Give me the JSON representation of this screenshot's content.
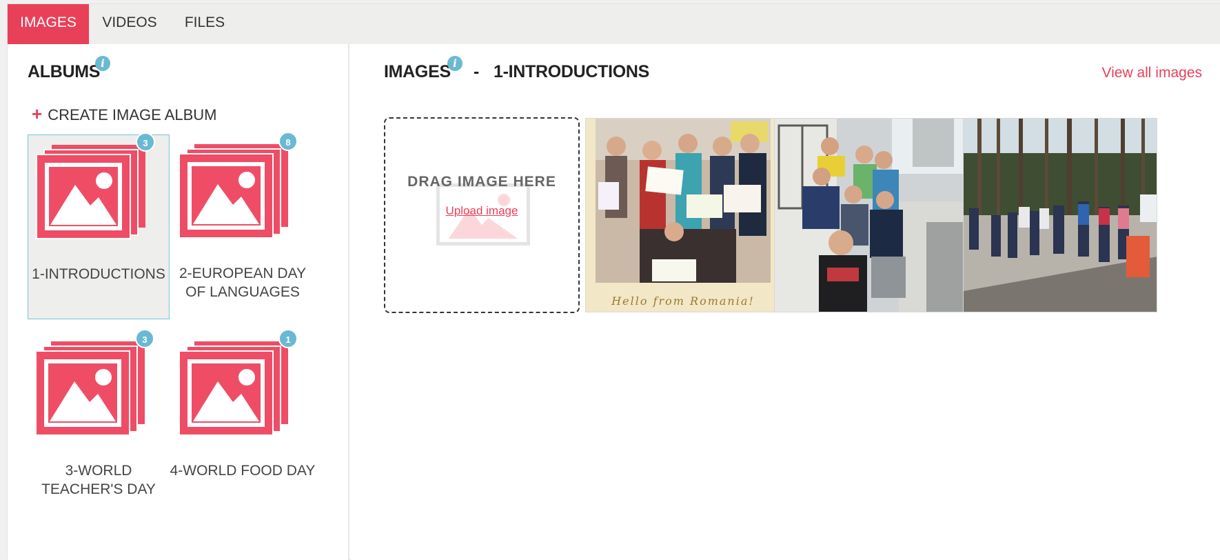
{
  "tabs": [
    {
      "label": "IMAGES",
      "active": true
    },
    {
      "label": "VIDEOS",
      "active": false
    },
    {
      "label": "FILES",
      "active": false
    }
  ],
  "albums_panel": {
    "title": "ALBUMS",
    "create_label": "CREATE IMAGE ALBUM",
    "items": [
      {
        "label": "1-INTRODUCTIONS",
        "count": "3",
        "selected": true
      },
      {
        "label": "2-EUROPEAN DAY OF LANGUAGES",
        "count": "8",
        "selected": false
      },
      {
        "label": "3-WORLD TEACHER'S DAY",
        "count": "3",
        "selected": false
      },
      {
        "label": "4-WORLD FOOD DAY",
        "count": "1",
        "selected": false
      }
    ]
  },
  "images_panel": {
    "title": "IMAGES",
    "separator": "-",
    "album_name": "1-INTRODUCTIONS",
    "view_all_label": "View all images",
    "dropzone": {
      "text": "DRAG IMAGE HERE",
      "upload_label": "Upload image"
    },
    "photo_caption": "Hello from Romania!"
  },
  "colors": {
    "accent": "#e94059",
    "info": "#6ab9d2",
    "album_icon": "#ef4d66"
  },
  "icons": {
    "info": "info-icon",
    "plus": "plus-icon",
    "album": "image-album-icon"
  }
}
